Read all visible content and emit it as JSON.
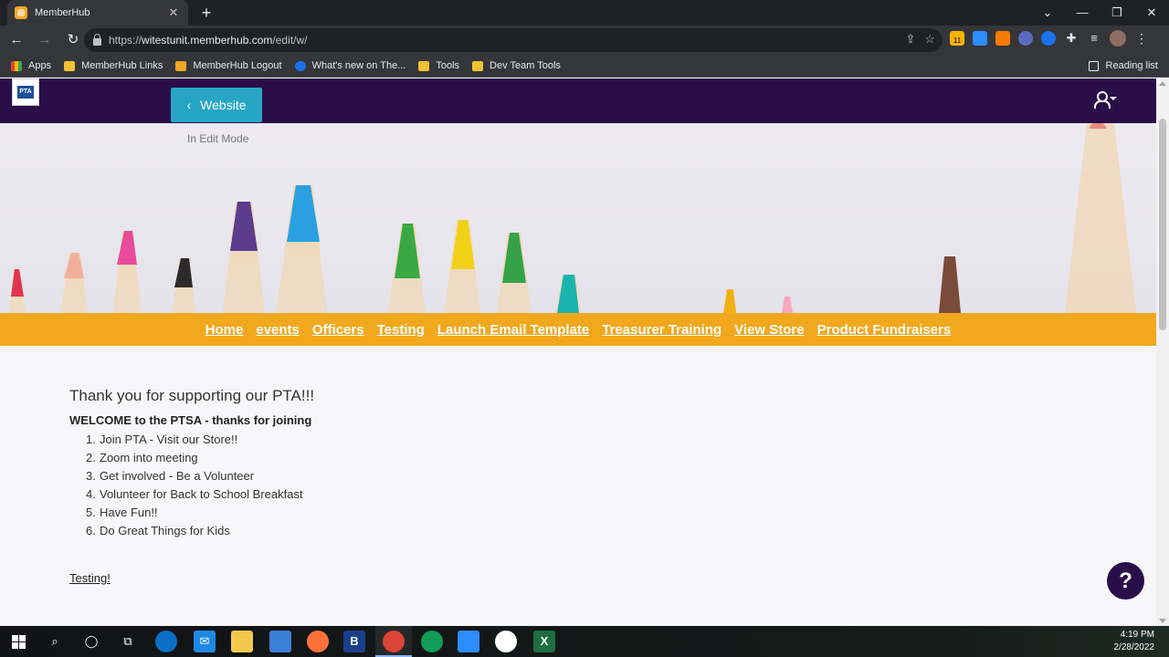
{
  "browser": {
    "tab_title": "MemberHub",
    "tab_close": "✕",
    "new_tab": "+",
    "url_prefix": "https://",
    "url_host": "witestunit.memberhub.com",
    "url_path": "/edit/w/",
    "window_controls": [
      "⌄",
      "—",
      "❐",
      "✕"
    ],
    "extension_badge": "11"
  },
  "bookmarks": {
    "items": [
      "Apps",
      "MemberHub Links",
      "MemberHub Logout",
      "What's new on The...",
      "Tools",
      "Dev Team Tools"
    ],
    "reading_list": "Reading list"
  },
  "site": {
    "logo_text": "PTA",
    "website_button": "Website",
    "edit_mode": "In Edit Mode",
    "nav_links": [
      "Home",
      "events",
      "Officers",
      "Testing",
      "Launch Email Template",
      "Treasurer Training",
      "View Store",
      "Product Fundraisers"
    ],
    "thanks": "Thank you for supporting our PTA!!!",
    "welcome": "WELCOME to the PTSA - thanks for joining",
    "steps": [
      "Join PTA - Visit our Store!!",
      "Zoom into meeting",
      "Get involved - Be a Volunteer",
      "Volunteer for Back to School Breakfast",
      "Have Fun!!",
      "Do Great Things for Kids"
    ],
    "testing_link": "Testing!",
    "help_button": "?"
  },
  "taskbar": {
    "time": "4:19 PM",
    "date": "2/28/2022"
  },
  "colors": {
    "header": "#2a0e4a",
    "nav_bar": "#f2a81d",
    "website_button": "#26a5c4"
  }
}
